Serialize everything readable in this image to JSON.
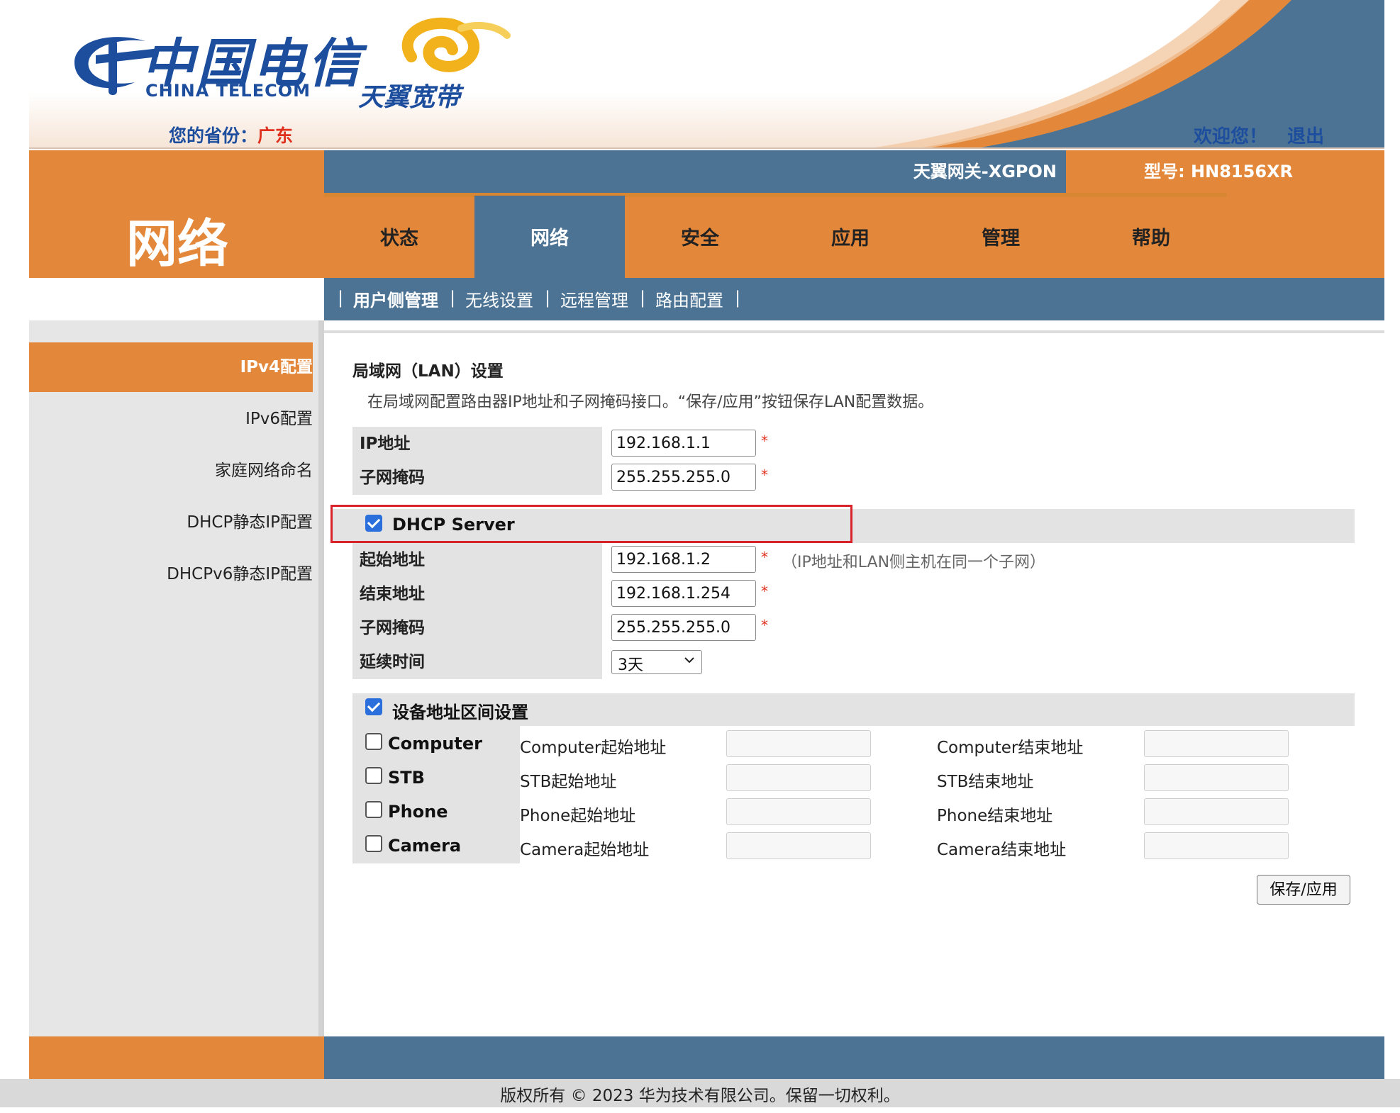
{
  "header": {
    "logo_cn": "中国电信",
    "logo_en": "CHINA TELECOM",
    "sub_brand": "天翼宽带",
    "province_label": "您的省份：",
    "province_value": "广东",
    "welcome": "欢迎您！",
    "logout": "退出",
    "gateway_name": "天翼网关-XGPON",
    "model": "型号: HN8156XR"
  },
  "section_title": "网络",
  "main_tabs": [
    {
      "label": "状态",
      "active": false
    },
    {
      "label": "网络",
      "active": true
    },
    {
      "label": "安全",
      "active": false
    },
    {
      "label": "应用",
      "active": false
    },
    {
      "label": "管理",
      "active": false
    },
    {
      "label": "帮助",
      "active": false
    }
  ],
  "sub_nav": {
    "separator": "|",
    "items": [
      {
        "label": "用户侧管理",
        "active": true
      },
      {
        "label": "无线设置",
        "active": false
      },
      {
        "label": "远程管理",
        "active": false
      },
      {
        "label": "路由配置",
        "active": false
      }
    ]
  },
  "sidebar": {
    "items": [
      {
        "label": "IPv4配置",
        "active": true
      },
      {
        "label": "IPv6配置",
        "active": false
      },
      {
        "label": "家庭网络命名",
        "active": false
      },
      {
        "label": "DHCP静态IP配置",
        "active": false
      },
      {
        "label": "DHCPv6静态IP配置",
        "active": false
      }
    ]
  },
  "content": {
    "title": "局域网（LAN）设置",
    "description": "在局域网配置路由器IP地址和子网掩码接口。“保存/应用”按钮保存LAN配置数据。",
    "required_mark": "*",
    "lan": {
      "ip_label": "IP地址",
      "ip_value": "192.168.1.1",
      "mask_label": "子网掩码",
      "mask_value": "255.255.255.0"
    },
    "dhcp": {
      "label": "DHCP Server",
      "checked": true,
      "start_label": "起始地址",
      "start_value": "192.168.1.2",
      "start_hint": "（IP地址和LAN侧主机在同一个子网）",
      "end_label": "结束地址",
      "end_value": "192.168.1.254",
      "mask_label": "子网掩码",
      "mask_value": "255.255.255.0",
      "lease_label": "延续时间",
      "lease_value": "3天"
    },
    "device_range": {
      "label": "设备地址区间设置",
      "checked": true,
      "devices": [
        {
          "name": "Computer",
          "start_label": "Computer起始地址",
          "end_label": "Computer结束地址",
          "checked": false,
          "start_value": "",
          "end_value": ""
        },
        {
          "name": "STB",
          "start_label": "STB起始地址",
          "end_label": "STB结束地址",
          "checked": false,
          "start_value": "",
          "end_value": ""
        },
        {
          "name": "Phone",
          "start_label": "Phone起始地址",
          "end_label": "Phone结束地址",
          "checked": false,
          "start_value": "",
          "end_value": ""
        },
        {
          "name": "Camera",
          "start_label": "Camera起始地址",
          "end_label": "Camera结束地址",
          "checked": false,
          "start_value": "",
          "end_value": ""
        }
      ]
    },
    "save_label": "保存/应用"
  },
  "footer": {
    "copyright": "版权所有 © 2023 华为技术有限公司。保留一切权利。"
  },
  "colors": {
    "orange": "#e3883a",
    "steel_blue": "#4c7394",
    "brand_blue": "#1d4e9e",
    "required_red": "#e0301e",
    "highlight_red": "#d8232a",
    "checkbox_blue": "#2a6fdb"
  },
  "icons": {
    "logo": "china-telecom-logo-icon",
    "sub_brand": "tianyi-swirl-icon",
    "select": "chevron-down-icon",
    "checkbox_on": "checkbox-checked-icon"
  }
}
